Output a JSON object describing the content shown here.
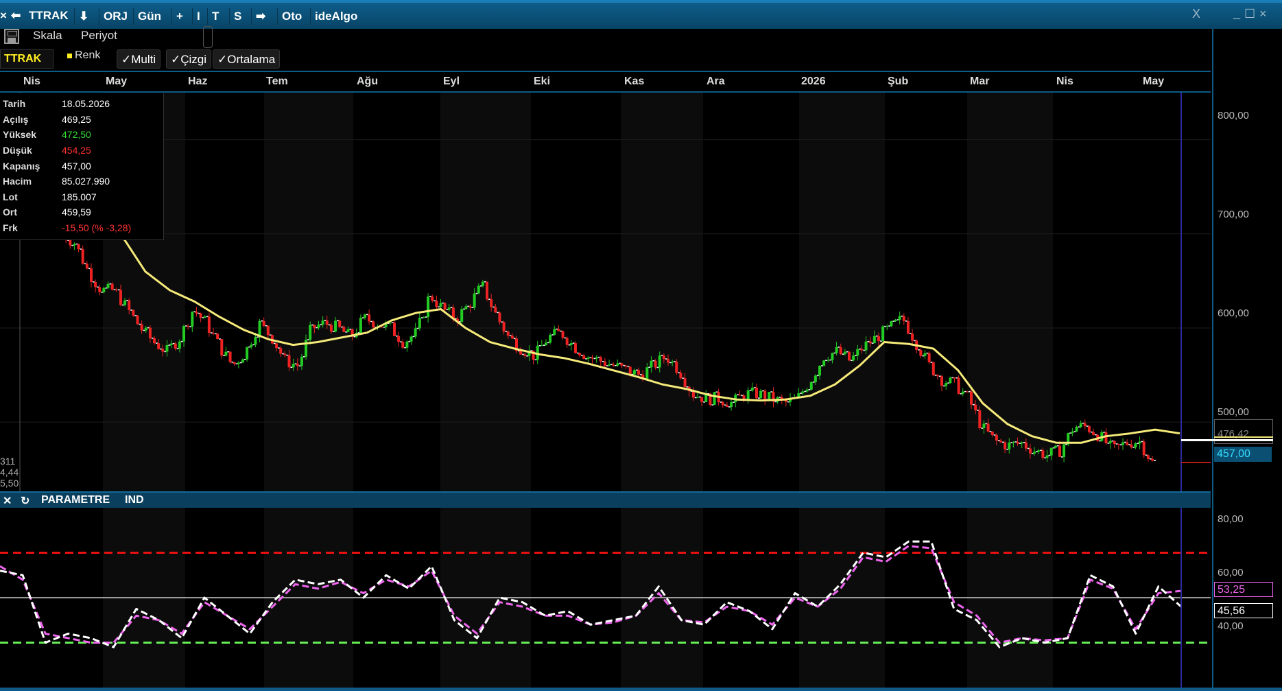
{
  "titlebar": {
    "close": "×",
    "back": "⬅",
    "symbol": "TTRAK",
    "buttons": [
      "⬇",
      "ORJ",
      "Gün",
      "+",
      "I",
      "T",
      "S",
      "➡",
      "Oto",
      "ideAlgo"
    ],
    "window_close": "X",
    "window_min": "_",
    "window_max": "☐",
    "window_x": "×"
  },
  "toolbar": {
    "save_icon": "save-icon",
    "skala": "Skala",
    "periyot": "Periyot"
  },
  "legend_bar": {
    "symbol": "TTRAK",
    "renk": "Renk",
    "multi": "✓Multi",
    "cizgi": "✓Çizgi",
    "ortalama": "✓Ortalama"
  },
  "months": [
    "Nis",
    "May",
    "Haz",
    "Tem",
    "Ağu",
    "Eyl",
    "Eki",
    "Kas",
    "Ara",
    "2026",
    "Şub",
    "Mar",
    "Nis",
    "May"
  ],
  "info": {
    "rows": [
      {
        "key": "Tarih",
        "value": "18.05.2026",
        "color": "#ffffff"
      },
      {
        "key": "Açılış",
        "value": "469,25",
        "color": "#ffffff"
      },
      {
        "key": "Yüksek",
        "value": "472,50",
        "color": "#33dd33"
      },
      {
        "key": "Düşük",
        "value": "454,25",
        "color": "#ff3333"
      },
      {
        "key": "Kapanış",
        "value": "457,00",
        "color": "#ffffff"
      },
      {
        "key": "Hacim",
        "value": "85.027.990",
        "color": "#ffffff"
      },
      {
        "key": "Lot",
        "value": "185.007",
        "color": "#ffffff"
      },
      {
        "key": "Ort",
        "value": "459,59",
        "color": "#ffffff"
      },
      {
        "key": "Frk",
        "value": "-15,50 (% -3,28)",
        "color": "#ff3333"
      }
    ]
  },
  "side_partial": [
    "311",
    "4,44",
    "5,50"
  ],
  "price_axis": {
    "labels": [
      "800,00",
      "700,00",
      "600,00",
      "500,00"
    ],
    "current_price": "457,00",
    "partial_label": "476,42"
  },
  "osc_bar": {
    "close": "✕",
    "refresh": "↻",
    "parametre": "PARAMETRE",
    "ind": "IND"
  },
  "osc_axis": {
    "labels": [
      "80,00",
      "60,00",
      "40,00"
    ],
    "value1": "53,25",
    "value2": "45,56"
  },
  "colors": {
    "up": "#22cc22",
    "down": "#ee2222",
    "ma": "#f5ea7a",
    "osc_main": "#ffffff",
    "osc_signal": "#ee66ee",
    "upper_band": "#ee1111",
    "lower_band": "#66ee55",
    "accent": "#0d5b86"
  },
  "chart_data": [
    {
      "type": "candlestick",
      "title": "TTRAK",
      "ylim": [
        425,
        850
      ],
      "y_ticks": [
        500,
        600,
        700,
        800
      ],
      "x_labels": [
        "Nis",
        "May",
        "Haz",
        "Tem",
        "Ağu",
        "Eyl",
        "Eki",
        "Kas",
        "Ara",
        "2026",
        "Şub",
        "Mar",
        "Nis",
        "May"
      ],
      "close_path": [
        700,
        690,
        660,
        640,
        640,
        620,
        600,
        585,
        575,
        590,
        620,
        605,
        580,
        560,
        575,
        605,
        590,
        565,
        560,
        600,
        605,
        600,
        590,
        610,
        605,
        600,
        585,
        595,
        635,
        620,
        610,
        625,
        645,
        615,
        590,
        578,
        570,
        590,
        595,
        580,
        570,
        565,
        560,
        555,
        550,
        560,
        570,
        555,
        530,
        525,
        525,
        520,
        530,
        530,
        525,
        520,
        525,
        545,
        570,
        575,
        565,
        580,
        590,
        600,
        610,
        585,
        560,
        545,
        540,
        525,
        495,
        480,
        475,
        478,
        470,
        465,
        470,
        495,
        495,
        485,
        470,
        478,
        480,
        457
      ],
      "moving_average": [
        760,
        700,
        660,
        640,
        628,
        612,
        598,
        588,
        582,
        585,
        590,
        595,
        608,
        616,
        620,
        600,
        585,
        578,
        572,
        568,
        562,
        555,
        548,
        540,
        535,
        528,
        524,
        523,
        524,
        528,
        540,
        560,
        585,
        583,
        578,
        555,
        520,
        498,
        485,
        478,
        478,
        485,
        488,
        492,
        488
      ],
      "last_price": 457.0
    },
    {
      "type": "line",
      "series": [
        {
          "values": [
            62,
            60,
            30,
            34,
            32,
            28,
            45,
            40,
            32,
            50,
            42,
            34,
            48,
            58,
            56,
            58,
            50,
            60,
            54,
            64,
            40,
            32,
            50,
            48,
            42,
            44,
            38,
            40,
            42,
            55,
            40,
            38,
            48,
            44,
            36,
            52,
            46,
            56,
            70,
            68,
            75,
            75,
            45,
            40,
            28,
            32,
            30,
            32,
            60,
            55,
            34,
            55,
            46
          ]
        },
        {
          "values": [
            64,
            58,
            34,
            32,
            30,
            30,
            42,
            40,
            34,
            48,
            42,
            36,
            46,
            56,
            54,
            57,
            52,
            58,
            55,
            62,
            42,
            34,
            48,
            46,
            42,
            42,
            38,
            39,
            42,
            52,
            40,
            39,
            46,
            44,
            38,
            50,
            46,
            54,
            68,
            66,
            73,
            72,
            48,
            42,
            30,
            32,
            31,
            32,
            58,
            54,
            36,
            52,
            53
          ]
        }
      ],
      "ylim": [
        10,
        90
      ],
      "y_ticks": [
        40,
        60,
        80
      ],
      "reference_lines": [
        70,
        30,
        50
      ],
      "last_values": [
        45.56,
        53.25
      ]
    }
  ]
}
